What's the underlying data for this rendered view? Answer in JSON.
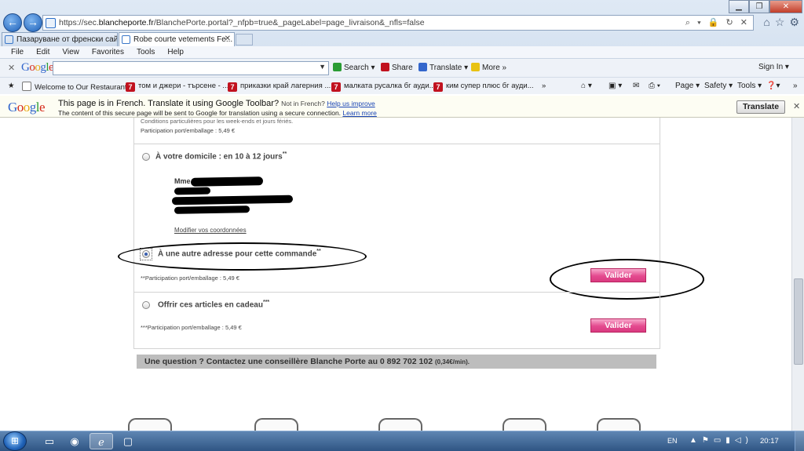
{
  "browser": {
    "url_prefix": "https://sec.",
    "url_domain": "blancheporte.fr",
    "url_rest": "/BlanchePorte.portal?_nfpb=true&_pageLabel=page_livraison&_nfls=false",
    "address_icons": "⌕ ▾ 🔒 ↻ ✕",
    "tabs": [
      {
        "label": "Пазаруване от френски сайт..."
      },
      {
        "label": "Robe courte vetements Fe..."
      }
    ],
    "menu": [
      "File",
      "Edit",
      "View",
      "Favorites",
      "Tools",
      "Help"
    ],
    "toolbar_icons": [
      "home-icon",
      "star-icon",
      "gear-icon"
    ]
  },
  "google_toolbar": {
    "logo_letters": [
      "G",
      "o",
      "o",
      "g",
      "l",
      "e"
    ],
    "search_label": "Search",
    "share_label": "Share",
    "translate_label": "Translate",
    "more_label": "More »",
    "signin_label": "Sign In"
  },
  "favorites": [
    {
      "label": "Welcome to Our Restaurant"
    },
    {
      "label": "том и джери - търсене - ..."
    },
    {
      "label": "приказки край лагерния ..."
    },
    {
      "label": "малката русалка бг ауди..."
    },
    {
      "label": "ким супер плюс бг ауди..."
    }
  ],
  "commandbar": {
    "page": "Page",
    "safety": "Safety",
    "tools": "Tools"
  },
  "translate_bar": {
    "line1": "This page is in French.  Translate it using Google Toolbar?",
    "not_french": "Not in French?",
    "help_link": "Help us improve",
    "line2": "The content of this secure page will be sent to Google for translation using a secure connection.",
    "learn_more": "Learn more",
    "button": "Translate"
  },
  "page": {
    "top_fragment": "Conditions particulières pour les week-ends et jours fériés.",
    "top_shipping": "Participation port/emballage : 5,49 €",
    "option_home": "À votre domicile : en 10 à 12 jours",
    "option_home_sup": "**",
    "address_salutation": "Mme",
    "modify_link": "Modifier vos coordonnées",
    "option_other": "À une autre adresse pour cette commande",
    "option_other_sup": "**",
    "other_shipping": "**Participation port/emballage : 5,49 €",
    "validate_label": "Valider",
    "option_gift": "Offrir ces articles en cadeau",
    "option_gift_sup": "***",
    "gift_shipping": "***Participation port/emballage : 5,49 €",
    "question_text": "Une question ? Contactez une conseillère Blanche Porte au 0 892 702 102",
    "question_rate": "(0,34€/min)."
  },
  "taskbar": {
    "language": "EN",
    "time": "20:17"
  }
}
